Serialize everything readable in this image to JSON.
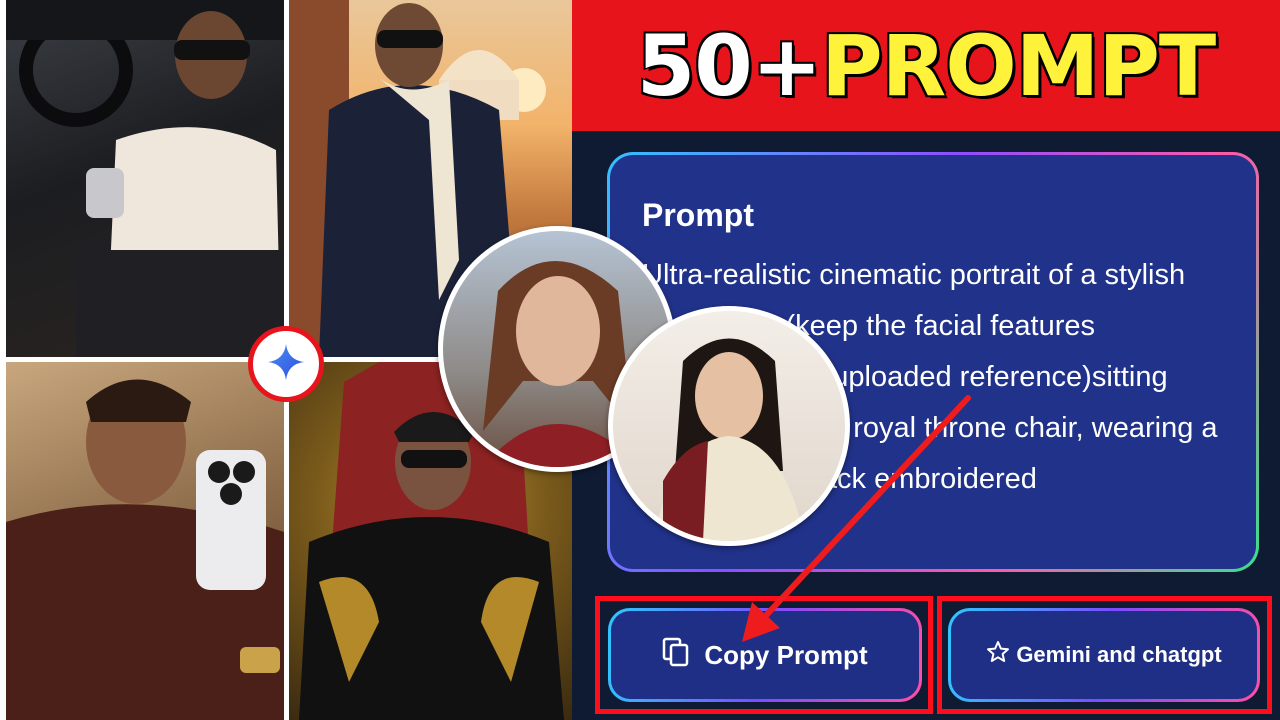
{
  "banner": {
    "number": "50+",
    "word": "PROMPT"
  },
  "prompt_card": {
    "title": "Prompt",
    "body": "Ultra-realistic cinematic portrait of a stylish young man(keep the facial features unchanged as uploaded reference)sitting confidently on a royal throne chair, wearing a black outfit (black embroidered"
  },
  "buttons": {
    "copy_label": "Copy Prompt",
    "gemini_label": "Gemini and chatgpt"
  },
  "icons": {
    "copy": "copy-icon",
    "star": "star-icon",
    "gemini": "gemini-sparkle-icon"
  },
  "colors": {
    "banner_red": "#e8141c",
    "banner_yellow": "#fff23a",
    "panel_bg": "#0f1a33",
    "card_bg": "#21328a",
    "highlight_red": "#ff0d1c",
    "gemini_blue": "#3b6cf6"
  }
}
